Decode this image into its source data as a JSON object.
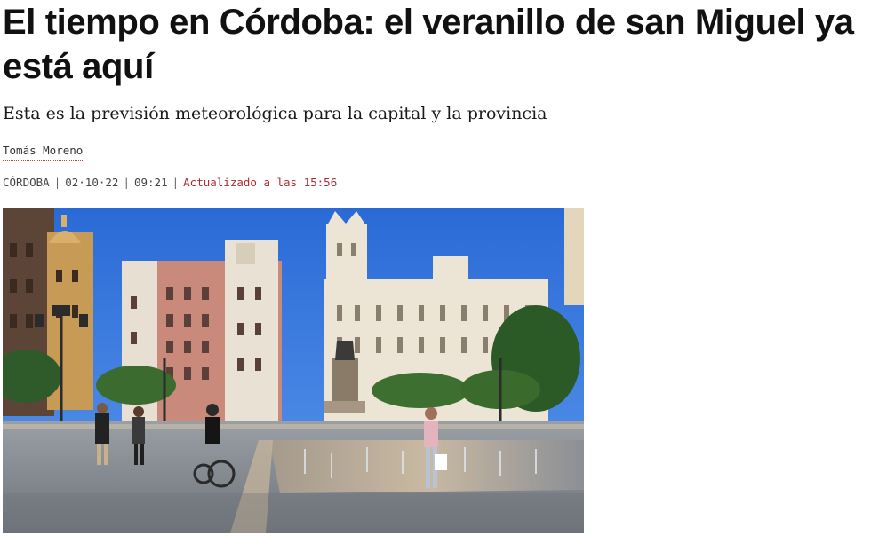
{
  "article": {
    "headline": "El tiempo en Córdoba: el veranillo de san Miguel ya está aquí",
    "subtitle": "Esta es la previsión meteorológica para la capital y la provincia",
    "author": "Tomás Moreno",
    "meta": {
      "section": "CÓRDOBA",
      "date": "02·10·22",
      "time": "09:21",
      "separator": "|",
      "updated": "Actualizado a las 15:56"
    }
  },
  "colors": {
    "accent": "#b0292f",
    "sky": "#2f72dc"
  }
}
